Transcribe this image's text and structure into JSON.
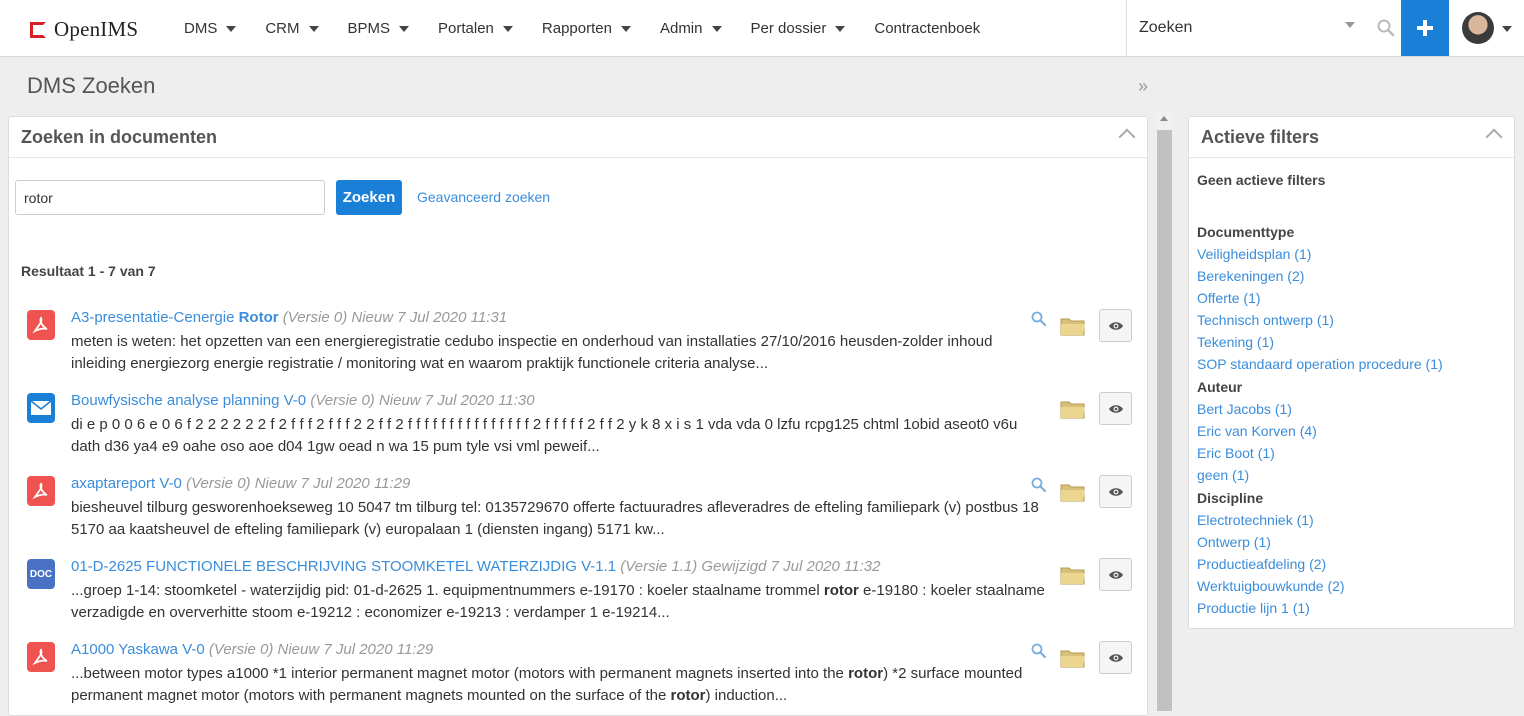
{
  "app": {
    "logo_text": "OpenIMS"
  },
  "nav": {
    "items": [
      {
        "label": "DMS",
        "dropdown": true
      },
      {
        "label": "CRM",
        "dropdown": true
      },
      {
        "label": "BPMS",
        "dropdown": true
      },
      {
        "label": "Portalen",
        "dropdown": true
      },
      {
        "label": "Rapporten",
        "dropdown": true
      },
      {
        "label": "Admin",
        "dropdown": true
      },
      {
        "label": "Per dossier",
        "dropdown": true
      },
      {
        "label": "Contractenboek",
        "dropdown": false
      }
    ],
    "search_placeholder": "Zoeken",
    "plus_icon": "plus-icon",
    "accent": "#1a7fd6"
  },
  "page": {
    "title": "DMS Zoeken"
  },
  "search_panel": {
    "title": "Zoeken in documenten",
    "query_value": "rotor",
    "search_button": "Zoeken",
    "advanced_link": "Geavanceerd zoeken",
    "result_count": "Resultaat 1 - 7 van 7"
  },
  "results": [
    {
      "icon": "pdf",
      "title_parts": [
        {
          "t": "A3-presentatie-Cenergie ",
          "b": false
        },
        {
          "t": "Rotor",
          "b": true
        }
      ],
      "meta": " (Versie 0) Nieuw 7 Jul 2020 11:31",
      "snippet": [
        {
          "t": "meten is weten: het opzetten van een energieregistratie cedubo inspectie en onderhoud van installaties 27/10/2016 heusden-zolder inhoud inleiding energiezorg energie registratie / monitoring wat en waarom praktijk functionele criteria analyse...",
          "b": false
        }
      ],
      "has_preview": true
    },
    {
      "icon": "mail",
      "title_parts": [
        {
          "t": "Bouwfysische analyse planning V-0",
          "b": false
        }
      ],
      "meta": " (Versie 0) Nieuw 7 Jul 2020 11:30",
      "snippet": [
        {
          "t": "di e p 0 0 6 e 0 6 f 2 2 2 2 2 2 f 2 f f f 2 f f f 2 2 f f 2 f f f f f f f f f f f f f f f 2 f f f f f 2 f f 2 y k 8 x i s 1 vda vda 0 lzfu rcpg125 chtml 1obid aseot0 v6u dath d36 ya4 e9 oahe oso aoe d04 1gw oead n wa 15 pum tyle vsi vml peweif...",
          "b": false
        }
      ],
      "has_preview": false
    },
    {
      "icon": "pdf",
      "title_parts": [
        {
          "t": "axaptareport V-0",
          "b": false
        }
      ],
      "meta": " (Versie 0) Nieuw 7 Jul 2020 11:29",
      "snippet": [
        {
          "t": "biesheuvel tilburg gesworenhoekseweg 10 5047 tm tilburg tel: 0135729670 offerte factuuradres afleveradres de efteling familiepark (v) postbus 18 5170 aa kaatsheuvel de efteling familiepark (v) europalaan 1 (diensten ingang) 5171 kw...",
          "b": false
        }
      ],
      "has_preview": true
    },
    {
      "icon": "doc",
      "title_parts": [
        {
          "t": "01-D-2625 FUNCTIONELE BESCHRIJVING STOOMKETEL WATERZIJDIG V-1.1",
          "b": false
        }
      ],
      "meta": " (Versie 1.1) Gewijzigd 7 Jul 2020 11:32",
      "snippet": [
        {
          "t": "...groep 1-14: stoomketel - waterzijdig pid: 01-d-2625 1. equipmentnummers e-19170 : koeler staalname trommel ",
          "b": false
        },
        {
          "t": "rotor",
          "b": true
        },
        {
          "t": " e-19180 : koeler staalname verzadigde en oververhitte stoom e-19212 : economizer e-19213 : verdamper 1 e-19214...",
          "b": false
        }
      ],
      "has_preview": false
    },
    {
      "icon": "pdf",
      "title_parts": [
        {
          "t": "A1000 Yaskawa V-0",
          "b": false
        }
      ],
      "meta": " (Versie 0) Nieuw 7 Jul 2020 11:29",
      "snippet": [
        {
          "t": "...between motor types a1000 *1 interior permanent magnet motor (motors with permanent magnets inserted into the ",
          "b": false
        },
        {
          "t": "rotor",
          "b": true
        },
        {
          "t": ") *2 surface mounted permanent magnet motor (motors with permanent magnets mounted on the surface of the ",
          "b": false
        },
        {
          "t": "rotor",
          "b": true
        },
        {
          "t": ") induction...",
          "b": false
        }
      ],
      "has_preview": true
    }
  ],
  "filters": {
    "title": "Actieve filters",
    "none_label": "Geen actieve filters",
    "groups": [
      {
        "title": "Documenttype",
        "items": [
          "Veiligheidsplan (1)",
          "Berekeningen (2)",
          "Offerte (1)",
          "Technisch ontwerp (1)",
          "Tekening (1)",
          "SOP standaard operation procedure (1)"
        ]
      },
      {
        "title": "Auteur",
        "items": [
          "Bert Jacobs (1)",
          "Eric van Korven (4)",
          "Eric Boot (1)",
          "geen (1)"
        ]
      },
      {
        "title": "Discipline",
        "items": [
          "Electrotechniek (1)",
          "Ontwerp (1)",
          "Productieafdeling (2)",
          "Werktuigbouwkunde (2)",
          "Productie lijn 1 (1)"
        ]
      }
    ]
  },
  "colors": {
    "pdf": "#ef5350",
    "mail": "#1a7fd6",
    "doc": "#4a72c4",
    "link": "#3a8ddb"
  }
}
